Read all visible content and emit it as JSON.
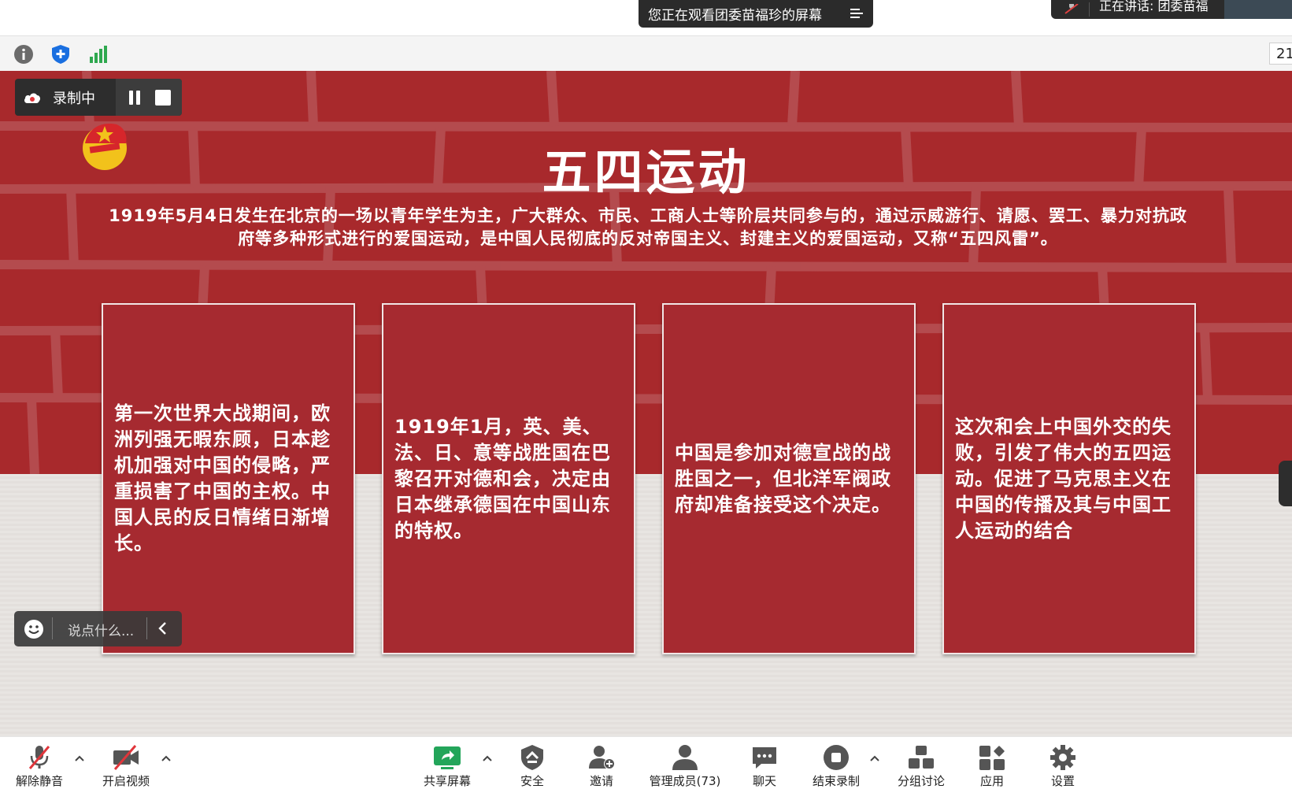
{
  "meeting": {
    "viewing_banner": "您正在观看团委苗福珍的屏幕",
    "speaker_label": "正在讲话: 团委苗福",
    "zoom_level": "21"
  },
  "recording": {
    "status": "录制中"
  },
  "slide": {
    "title": "五四运动",
    "intro": "1919年5月4日发生在北京的一场以青年学生为主，广大群众、市民、工商人士等阶层共同参与的，通过示威游行、请愿、罢工、暴力对抗政府等多种形式进行的爱国运动，是中国人民彻底的反对帝国主义、封建主义的爱国运动，又称“五四风雷”。",
    "cards": [
      "第一次世界大战期间，欧洲列强无暇东顾，日本趁机加强对中国的侵略，严重损害了中国的主权。中国人民的反日情绪日渐增长。",
      "1919年1月，英、美、法、日、意等战胜国在巴黎召开对德和会，决定由日本继承德国在中国山东的特权。",
      "中国是参加对德宣战的战胜国之一，但北洋军阀政府却准备接受这个决定。",
      "这次和会上中国外交的失败，引发了伟大的五四运动。促进了马克思主义在中国的传播及其与中国工人运动的结合"
    ]
  },
  "comment": {
    "placeholder": "说点什么..."
  },
  "toolbar": {
    "unmute": "解除静音",
    "start_video": "开启视频",
    "share_screen": "共享屏幕",
    "security": "安全",
    "invite": "邀请",
    "participants": "管理成员(73)",
    "chat": "聊天",
    "end_recording": "结束录制",
    "breakout": "分组讨论",
    "apps": "应用",
    "settings": "设置"
  },
  "colors": {
    "wall_red": "#a8292c",
    "card_red": "#a62a30",
    "dark_panel": "#2b2b2b"
  }
}
